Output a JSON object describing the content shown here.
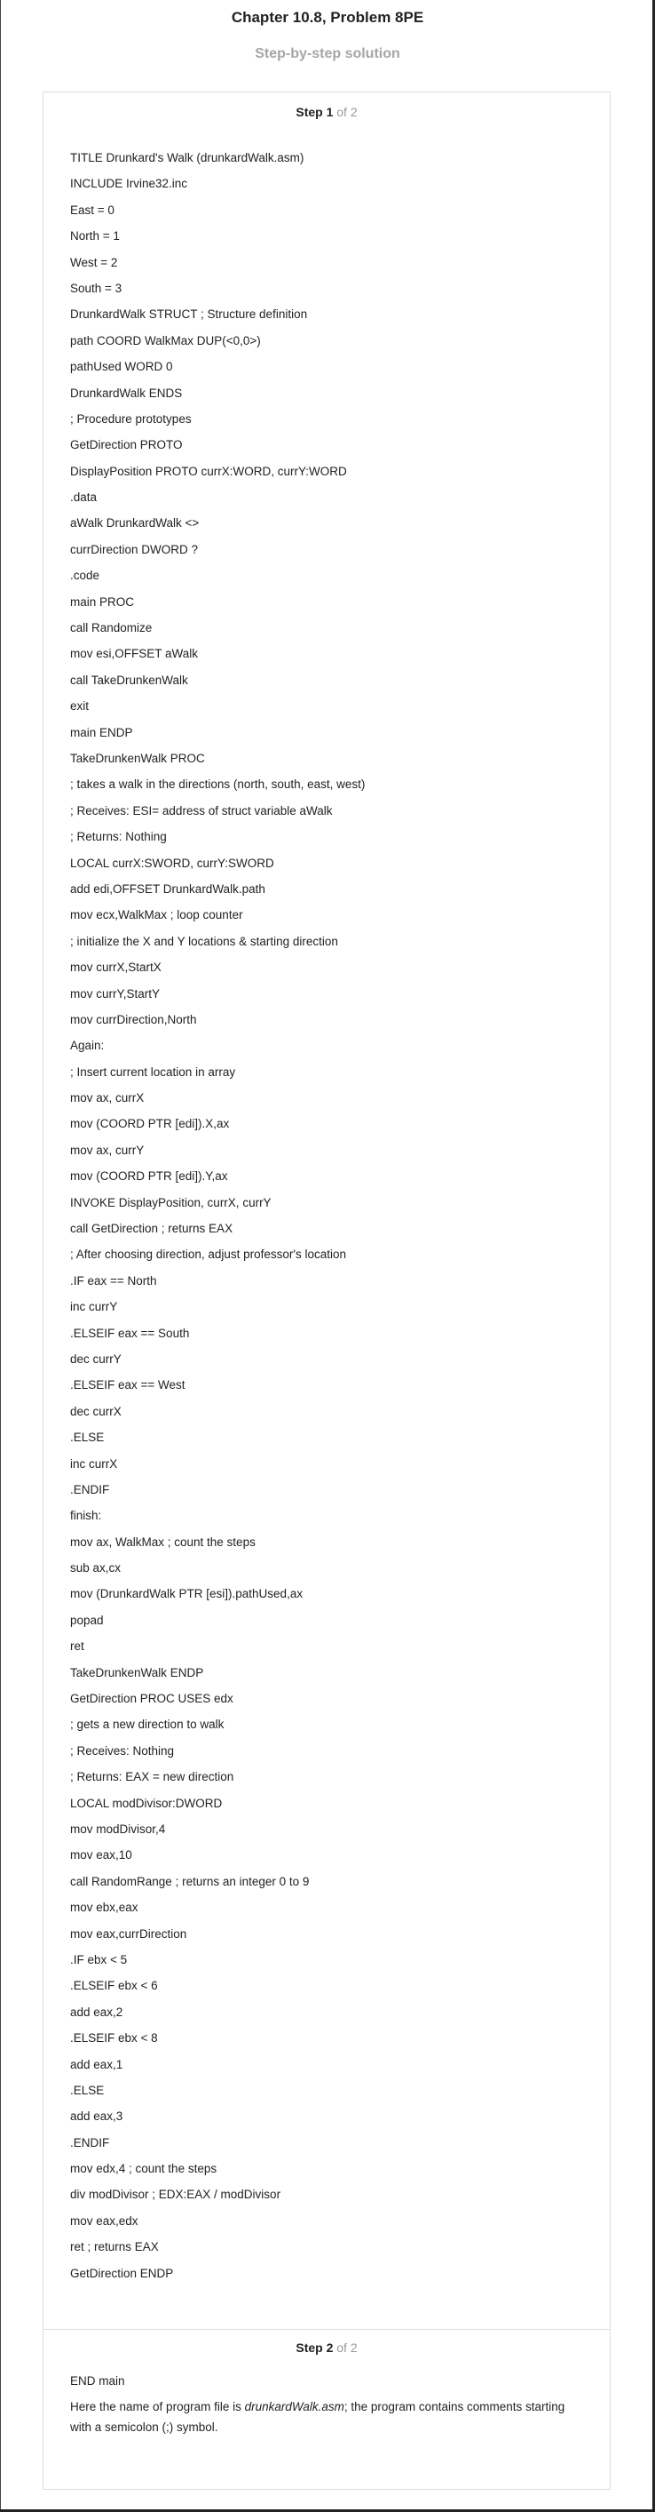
{
  "header": {
    "title": "Chapter 10.8, Problem 8PE",
    "subtitle": "Step-by-step solution"
  },
  "step1": {
    "label": "Step 1",
    "of": "of 2",
    "lines": [
      "TITLE Drunkard's Walk (drunkardWalk.asm)",
      "INCLUDE Irvine32.inc",
      "East = 0",
      "North = 1",
      "West = 2",
      "South = 3",
      "DrunkardWalk STRUCT ; Structure definition",
      "path COORD WalkMax DUP(<0,0>)",
      "pathUsed WORD 0",
      "DrunkardWalk ENDS",
      "; Procedure prototypes",
      "GetDirection PROTO",
      "DisplayPosition PROTO currX:WORD, currY:WORD",
      ".data",
      "aWalk DrunkardWalk <>",
      "currDirection DWORD ?",
      ".code",
      "main PROC",
      "call Randomize",
      "mov esi,OFFSET aWalk",
      "call TakeDrunkenWalk",
      "exit",
      "main ENDP",
      "TakeDrunkenWalk PROC",
      "; takes a walk in the directions (north, south, east, west)",
      "; Receives: ESI= address of struct variable aWalk",
      "; Returns: Nothing",
      "LOCAL currX:SWORD, currY:SWORD",
      "add edi,OFFSET DrunkardWalk.path",
      "mov ecx,WalkMax ; loop counter",
      "; initialize the X and Y locations & starting direction",
      "mov currX,StartX",
      "mov currY,StartY",
      "mov currDirection,North",
      "Again:",
      "; Insert current location in array",
      "mov ax, currX",
      "mov (COORD PTR [edi]).X,ax",
      "mov ax, currY",
      "mov (COORD PTR [edi]).Y,ax",
      "INVOKE DisplayPosition, currX, currY",
      "call GetDirection ; returns EAX",
      "; After choosing direction, adjust professor's location",
      ".IF eax == North",
      "inc currY",
      ".ELSEIF eax == South",
      "dec currY",
      ".ELSEIF eax == West",
      "dec currX",
      ".ELSE",
      "inc currX",
      ".ENDIF",
      "finish:",
      "mov ax, WalkMax ; count the steps",
      "sub ax,cx",
      "mov (DrunkardWalk PTR [esi]).pathUsed,ax",
      "popad",
      "ret",
      "TakeDrunkenWalk ENDP",
      "GetDirection PROC USES edx",
      "; gets a new direction to walk",
      "; Receives: Nothing",
      "; Returns: EAX = new direction",
      "LOCAL modDivisor:DWORD",
      "mov modDivisor,4",
      "mov eax,10",
      "call RandomRange ; returns an integer 0 to 9",
      "mov ebx,eax",
      "mov eax,currDirection",
      ".IF ebx < 5",
      ".ELSEIF ebx < 6",
      "add eax,2",
      ".ELSEIF ebx < 8",
      "add eax,1",
      ".ELSE",
      "add eax,3",
      ".ENDIF",
      "mov edx,4 ; count the steps",
      "div modDivisor ; EDX:EAX / modDivisor",
      "mov eax,edx",
      "ret ; returns EAX",
      "GetDirection ENDP"
    ]
  },
  "step2": {
    "label": "Step 2",
    "of": "of 2",
    "line": "END main",
    "para_prefix": "Here the name of program file is ",
    "para_filename": "drunkardWalk.asm",
    "para_suffix": "; the program contains comments starting with a semicolon (;) symbol."
  }
}
